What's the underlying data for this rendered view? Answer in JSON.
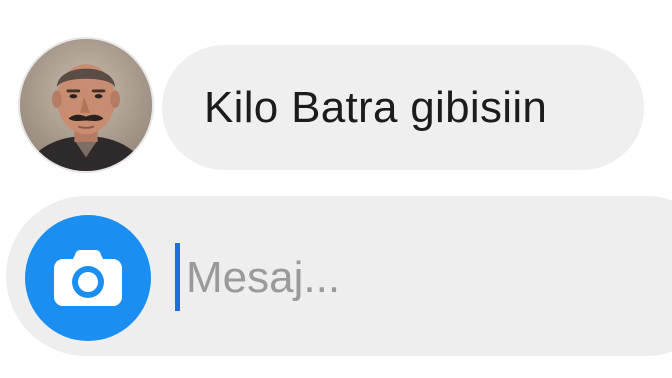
{
  "conversation": {
    "avatar_icon": "contact-photo-icon",
    "message": "Kilo Batra gibisiin"
  },
  "composer": {
    "camera_icon": "camera-icon",
    "placeholder": "Mesaj...",
    "value": "",
    "accent_color": "#1b8ef2",
    "bubble_color": "#efefef"
  }
}
